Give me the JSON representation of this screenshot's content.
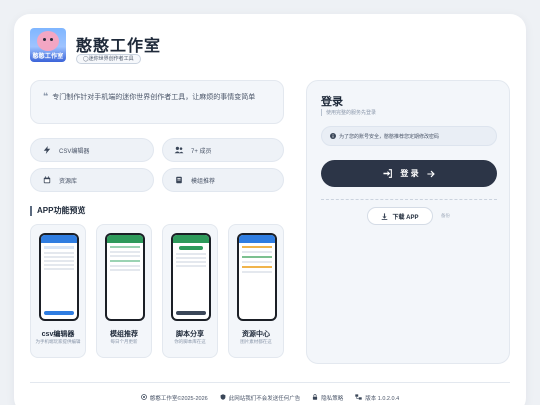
{
  "header": {
    "logo_text": "憨憨工作室",
    "title": "憨憨工作室",
    "subtitle": "◯迷你世界创作者工具"
  },
  "intro": {
    "quote_mark": "❝",
    "text": "专门制作针对手机端的迷你世界创作者工具，让麻烦的事情变简单"
  },
  "features": [
    {
      "icon": "lightning-icon",
      "label": "CSV编辑器"
    },
    {
      "icon": "users-icon",
      "label": "7+ 成员"
    },
    {
      "icon": "calendar-icon",
      "label": "资源库"
    },
    {
      "icon": "book-icon",
      "label": "模组推荐"
    }
  ],
  "preview": {
    "section_title": "APP功能预览",
    "cards": [
      {
        "title": "csv编辑器",
        "desc": "为手机端玩家提供编辑"
      },
      {
        "title": "模组推荐",
        "desc": "每日个月更新"
      },
      {
        "title": "脚本分享",
        "desc": "你的脚本库在这"
      },
      {
        "title": "资源中心",
        "desc": "图片素材都在这"
      }
    ]
  },
  "login": {
    "title": "登录",
    "subtitle": "使用完整的服务先登录",
    "info_text": "为了您的账号安全，憨憨推荐您定期修改密码",
    "button_label": "登 录",
    "download_label": "下载 APP",
    "download_note": "备份"
  },
  "footer": {
    "copyright": "憨憨工作室©2025-2026",
    "notice": "此网站我们不会发送任何广告",
    "privacy": "隐私策略",
    "version": "版本 1.0.2.0.4"
  },
  "colors": {
    "primary_button": "#2c3547",
    "background": "#eef1f5"
  }
}
